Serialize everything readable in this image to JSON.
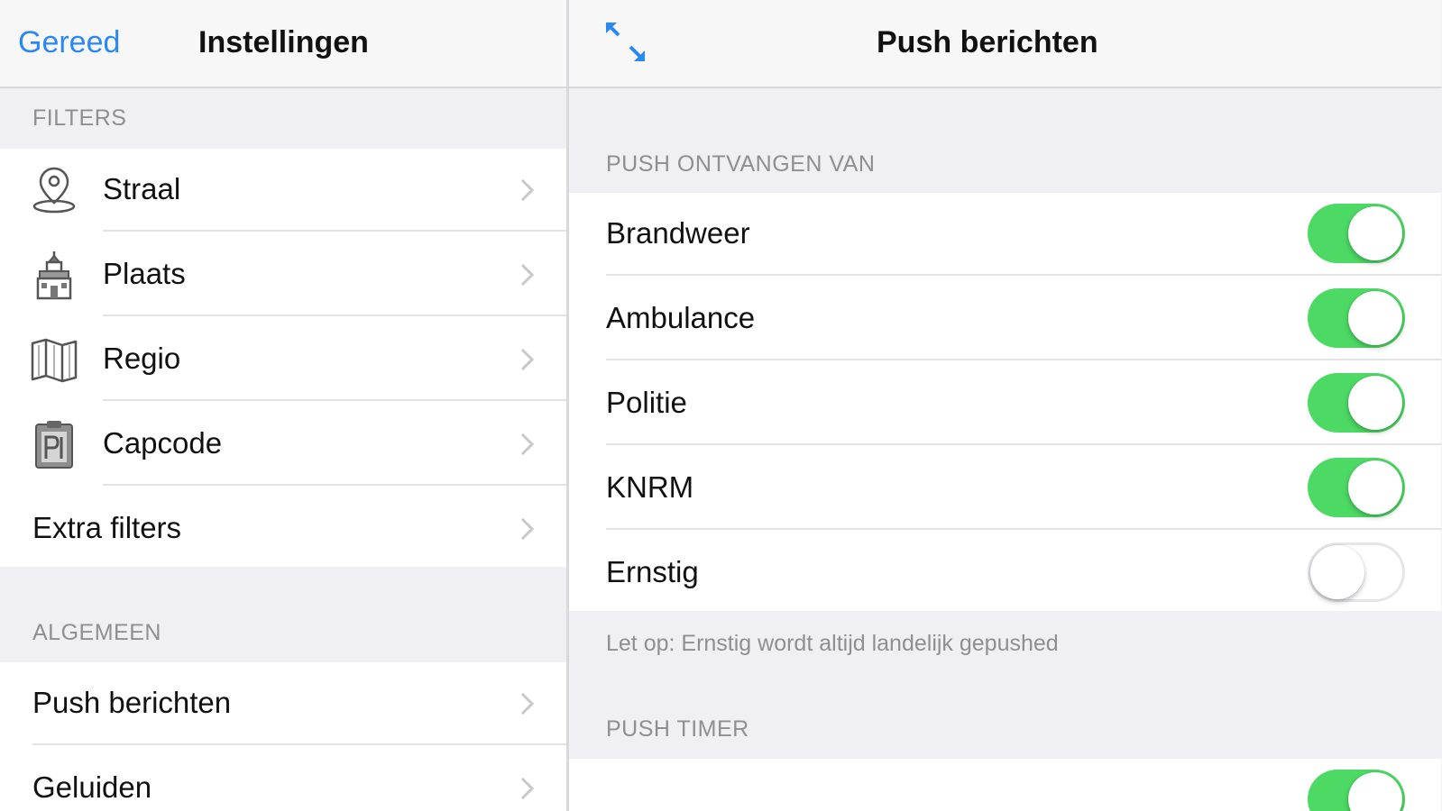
{
  "left_pane": {
    "nav": {
      "done_label": "Gereed",
      "title": "Instellingen"
    },
    "filters": {
      "header": "FILTERS",
      "items": [
        {
          "label": "Straal",
          "icon": "map-pin-icon"
        },
        {
          "label": "Plaats",
          "icon": "town-hall-icon"
        },
        {
          "label": "Regio",
          "icon": "folded-map-icon"
        },
        {
          "label": "Capcode",
          "icon": "clipboard-icon"
        },
        {
          "label": "Extra filters"
        }
      ]
    },
    "general": {
      "header": "ALGEMEEN",
      "items": [
        {
          "label": "Push berichten"
        },
        {
          "label": "Geluiden"
        }
      ]
    }
  },
  "right_pane": {
    "nav": {
      "title": "Push berichten",
      "expand_icon": "expand-arrows-icon"
    },
    "receive": {
      "header": "PUSH ONTVANGEN VAN",
      "items": [
        {
          "label": "Brandweer",
          "on": true
        },
        {
          "label": "Ambulance",
          "on": true
        },
        {
          "label": "Politie",
          "on": true
        },
        {
          "label": "KNRM",
          "on": true
        },
        {
          "label": "Ernstig",
          "on": false
        }
      ],
      "footer": "Let op: Ernstig wordt altijd landelijk gepushed"
    },
    "timer": {
      "header": "PUSH TIMER",
      "items": [
        {
          "label": "",
          "on": true
        }
      ]
    }
  },
  "colors": {
    "accent": "#2a88f5",
    "toggle_on": "#4cd964",
    "background": "#efeff4",
    "section_text": "#8e8e93"
  }
}
